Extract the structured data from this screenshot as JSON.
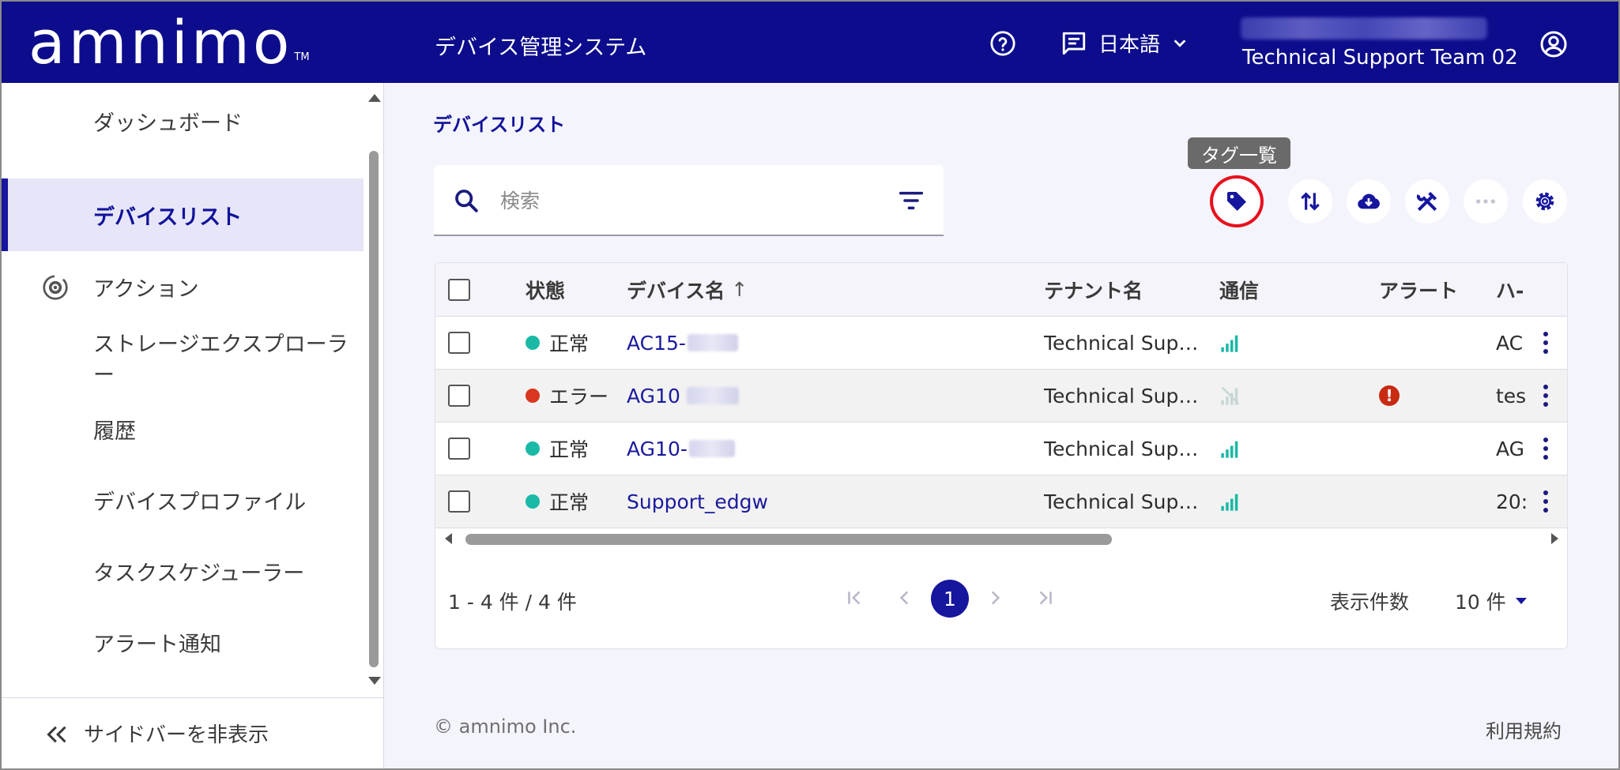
{
  "header": {
    "logo_text": "amnimo",
    "logo_tm": "TM",
    "app_title": "デバイス管理システム",
    "language": "日本語",
    "team": "Technical Support Team 02"
  },
  "sidebar": {
    "items": [
      {
        "label": "ダッシュボード"
      },
      {
        "label": "デバイスリスト"
      },
      {
        "label": "アクション"
      },
      {
        "label": "ストレージエクスプローラー"
      },
      {
        "label": "履歴"
      },
      {
        "label": "デバイスプロファイル"
      },
      {
        "label": "タスクスケジューラー"
      },
      {
        "label": "アラート通知"
      }
    ],
    "hide_label": "サイドバーを非表示"
  },
  "main": {
    "breadcrumb": "デバイスリスト",
    "search_placeholder": "検索",
    "tooltip": "タグ一覧",
    "columns": {
      "status": "状態",
      "device_name": "デバイス名",
      "sort_arrow": "↑",
      "tenant": "テナント名",
      "comm": "通信",
      "alert": "アラート",
      "hw": "ハ-"
    },
    "rows": [
      {
        "status": "正常",
        "status_color": "#1ab9a6",
        "name": "AC15-",
        "tenant": "Technical Sup…",
        "signal": "good",
        "alert": "",
        "hw": "AC"
      },
      {
        "status": "エラー",
        "status_color": "#d8361e",
        "name": "AG10",
        "tenant": "Technical Sup…",
        "signal": "none",
        "alert": "!",
        "hw": "tes"
      },
      {
        "status": "正常",
        "status_color": "#1ab9a6",
        "name": "AG10-",
        "tenant": "Technical Sup…",
        "signal": "good",
        "alert": "",
        "hw": "AG"
      },
      {
        "status": "正常",
        "status_color": "#1ab9a6",
        "name": "Support_edgw",
        "tenant": "Technical Sup…",
        "signal": "good",
        "alert": "",
        "hw": "20:"
      }
    ],
    "count_text": "1 - 4 件 / 4 件",
    "current_page": "1",
    "per_page_label": "表示件数",
    "per_page_value": "10 件"
  },
  "footer": {
    "copyright": "© amnimo Inc.",
    "terms": "利用規約"
  },
  "colors": {
    "header_bg": "#0c0c8c",
    "accent": "#16169e",
    "ok": "#1ab9a6",
    "error": "#d8361e",
    "highlight_ring": "#e8101c"
  }
}
